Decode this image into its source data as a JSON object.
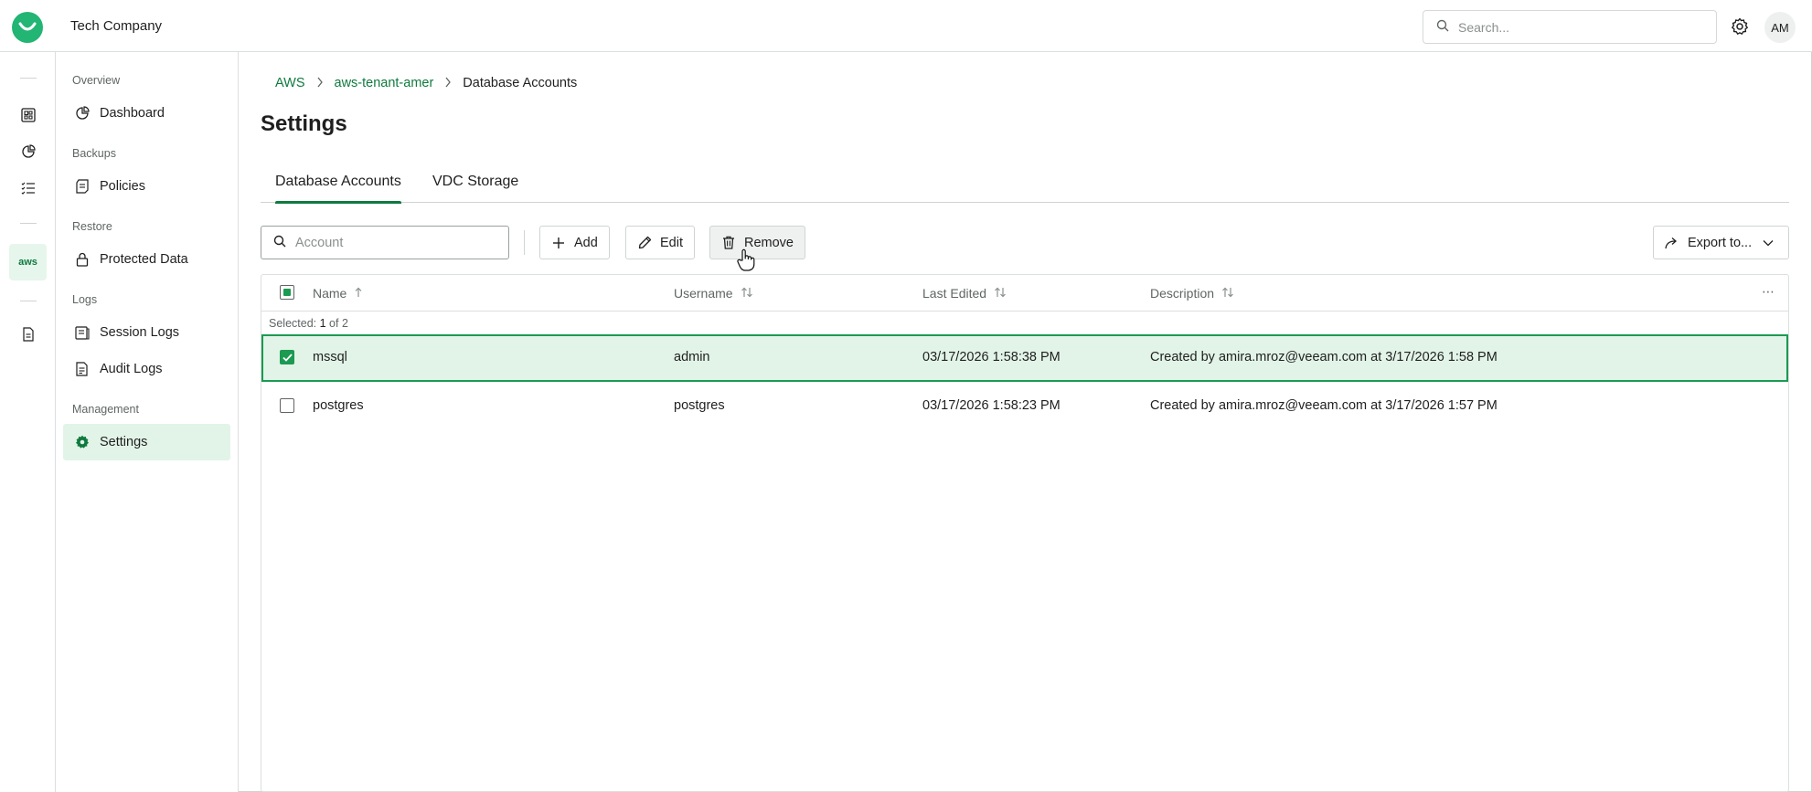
{
  "header": {
    "company": "Tech Company",
    "search_placeholder": "Search...",
    "avatar_initials": "AM"
  },
  "rail": {
    "aws_label": "aws",
    "icons": [
      "overview-grid-icon",
      "pie-chart-icon",
      "checklist-icon",
      "aws-icon",
      "document-icon"
    ]
  },
  "sidebar": {
    "sections": [
      {
        "title": "Overview",
        "items": [
          {
            "label": "Dashboard",
            "icon": "dashboard-icon"
          }
        ]
      },
      {
        "title": "Backups",
        "items": [
          {
            "label": "Policies",
            "icon": "policies-icon"
          }
        ]
      },
      {
        "title": "Restore",
        "items": [
          {
            "label": "Protected Data",
            "icon": "lock-icon"
          }
        ]
      },
      {
        "title": "Logs",
        "items": [
          {
            "label": "Session Logs",
            "icon": "session-logs-icon"
          },
          {
            "label": "Audit Logs",
            "icon": "audit-logs-icon"
          }
        ]
      },
      {
        "title": "Management",
        "items": [
          {
            "label": "Settings",
            "icon": "gear-icon",
            "active": true
          }
        ]
      }
    ]
  },
  "breadcrumb": {
    "items": [
      "AWS",
      "aws-tenant-amer"
    ],
    "current": "Database Accounts"
  },
  "page": {
    "title": "Settings",
    "tabs": [
      {
        "label": "Database Accounts",
        "active": true
      },
      {
        "label": "VDC Storage",
        "active": false
      }
    ]
  },
  "toolbar": {
    "search_placeholder": "Account",
    "add_label": "Add",
    "edit_label": "Edit",
    "remove_label": "Remove",
    "export_label": "Export to..."
  },
  "table": {
    "columns": {
      "name": "Name",
      "username": "Username",
      "last_edited": "Last Edited",
      "description": "Description"
    },
    "selection": {
      "prefix": "Selected:",
      "count": "1",
      "suffix": "of 2"
    },
    "rows": [
      {
        "name": "mssql",
        "username": "admin",
        "last_edited": "03/17/2026 1:58:38 PM",
        "description": "Created by amira.mroz@veeam.com at 3/17/2026 1:58 PM",
        "selected": true
      },
      {
        "name": "postgres",
        "username": "postgres",
        "last_edited": "03/17/2026 1:58:23 PM",
        "description": "Created by amira.mroz@veeam.com at 3/17/2026 1:57 PM",
        "selected": false
      }
    ]
  },
  "colors": {
    "accent": "#0f7a3e",
    "accent_bright": "#1b9a52",
    "selected_bg": "#e2f4e8",
    "logo": "#22b573"
  }
}
